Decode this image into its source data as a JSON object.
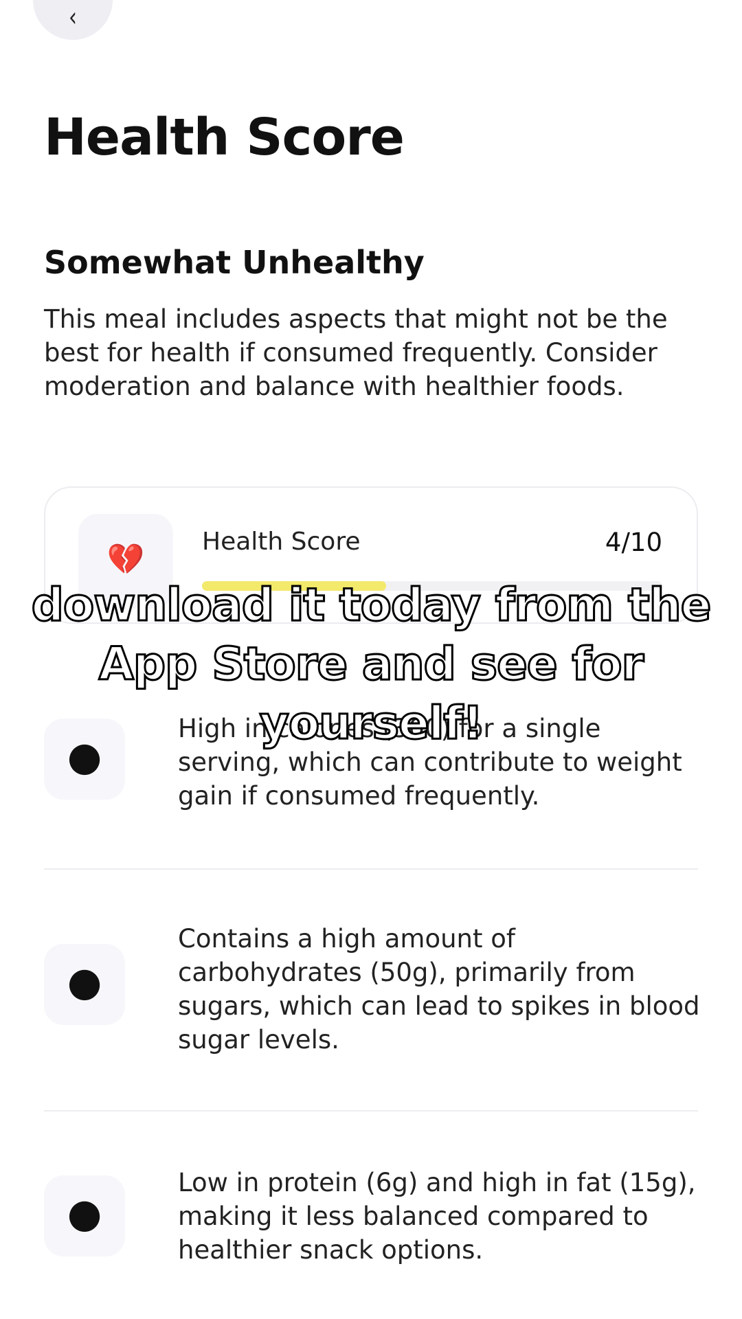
{
  "header": {
    "back_icon": "chevron-left-icon",
    "back_glyph": "‹"
  },
  "page_title": "Health Score",
  "verdict": {
    "title": "Somewhat Unhealthy",
    "description": "This meal includes aspects that might not be the best for health if consumed frequently. Consider moderation and balance with healthier foods."
  },
  "score_card": {
    "icon": "broken-heart-icon",
    "icon_glyph": "💔",
    "icon_color": "#e0609a",
    "label": "Health Score",
    "value": "4/10",
    "progress_fraction": 0.4,
    "bar_color": "#f3e96b"
  },
  "overlay_caption": "download it today from the App Store and see for yourself!",
  "issues": [
    {
      "icon": "apple-icon",
      "icon_glyph": "●",
      "text": "High in calories (300) for a single serving, which can contribute to weight gain if consumed frequently."
    },
    {
      "icon": "apple-icon",
      "icon_glyph": "●",
      "text": "Contains a high amount of carbohydrates (50g), primarily from sugars, which can lead to spikes in blood sugar levels."
    },
    {
      "icon": "apple-icon",
      "icon_glyph": "●",
      "text": "Low in protein (6g) and high in fat (15g), making it less balanced compared to healthier snack options."
    }
  ]
}
